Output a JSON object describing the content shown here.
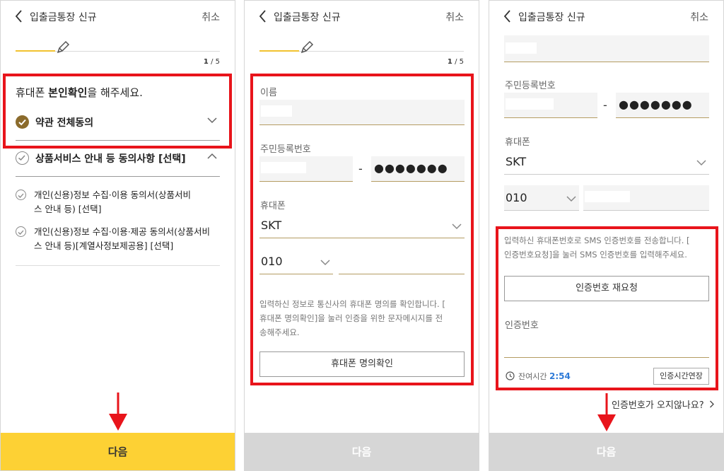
{
  "header": {
    "title": "입출금통장 신규",
    "cancel_label": "취소"
  },
  "progress": {
    "step_current": "1",
    "step_total": "/ 5",
    "fraction": 0.2
  },
  "panel1": {
    "title_prefix": "휴대폰 ",
    "title_bold": "본인확인",
    "title_suffix": "을 해주세요.",
    "agree_all": "약관 전체동의",
    "optional_group": "상품서비스 안내 등 동의사항 [선택]",
    "items": [
      {
        "line1": "개인(신용)정보 수집·이용 동의서(상품서비",
        "line2": "스 안내 등) [선택]"
      },
      {
        "line1": "개인(신용)정보 수집·이용·제공 동의서(상품서비",
        "line2": "스 안내 등)[계열사정보제공용] [선택]"
      }
    ],
    "next_label": "다음"
  },
  "panel2": {
    "name_label": "이름",
    "rrn_label": "주민등록번호",
    "rrn_dash": "-",
    "rrn_back": "●●●●●●●",
    "phone_label": "휴대폰",
    "carrier": "SKT",
    "prefix": "010",
    "notice_lines": [
      "입력하신 정보로 통신사의 휴대폰 명의를 확인합니다. [",
      "휴대폰 명의확인]을 눌러 인증을 위한 문자메시지를 전",
      "송해주세요."
    ],
    "verify_button": "휴대폰 명의확인",
    "next_label": "다음"
  },
  "panel3": {
    "rrn_label": "주민등록번호",
    "rrn_dash": "-",
    "rrn_back": "●●●●●●●",
    "phone_label": "휴대폰",
    "carrier": "SKT",
    "prefix": "010",
    "notice_lines": [
      "입력하신 휴대폰번호로 SMS 인증번호를 전송합니다. [",
      "인증번호요청]을 눌러 SMS 인증번호를 입력해주세요."
    ],
    "resend_button": "인증번호 재요청",
    "code_label": "인증번호",
    "remaining_label": "잔여시간",
    "remaining_value": "2:54",
    "extend_button": "인증시간연장",
    "help_link": "인증번호가 오지않나요?",
    "next_label": "다음"
  },
  "colors": {
    "accent_yellow": "#fdd134",
    "highlight_red": "#e8141b",
    "gold_check": "#8b6b2c",
    "timer_blue": "#2f7bd8"
  }
}
